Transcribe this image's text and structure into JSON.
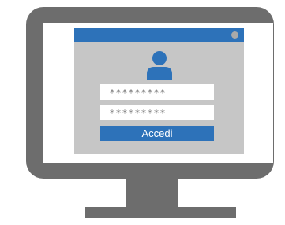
{
  "login": {
    "username_value": "*********",
    "password_value": "*********",
    "submit_label": "Accedi"
  },
  "colors": {
    "accent": "#2d72b9",
    "window_bg": "#c6c6c6",
    "monitor": "#6d6d6d"
  },
  "icons": {
    "user": "user-icon",
    "window_control": "window-dot-icon"
  }
}
